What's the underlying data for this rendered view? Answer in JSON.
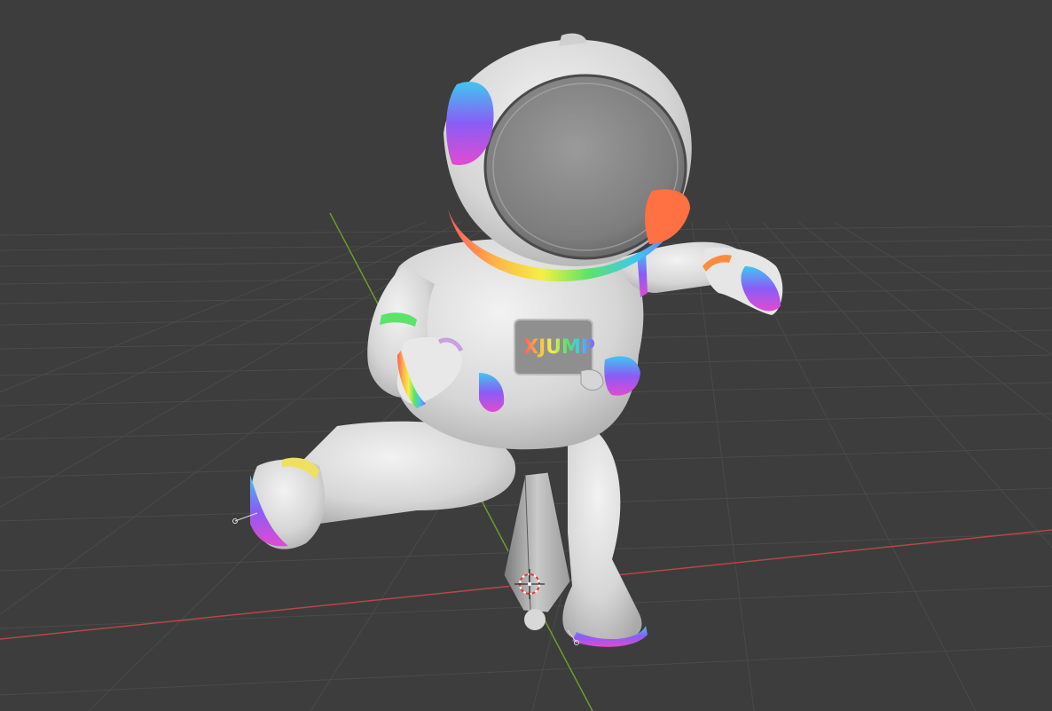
{
  "viewport": {
    "background": "#3d3d3d",
    "grid_color": "#4a4a4a",
    "x_axis_color": "#b5474a",
    "y_axis_color": "#6f9a2e"
  },
  "scene": {
    "object": "astronaut-mesh",
    "chest_patch_text": "XJUMP",
    "suit_color": "#d9d9d9",
    "accent_colors": [
      "#ff5a5a",
      "#ffb347",
      "#f4f046",
      "#5be36a",
      "#3fc7f0",
      "#8b5cf6",
      "#e04bd0"
    ]
  }
}
